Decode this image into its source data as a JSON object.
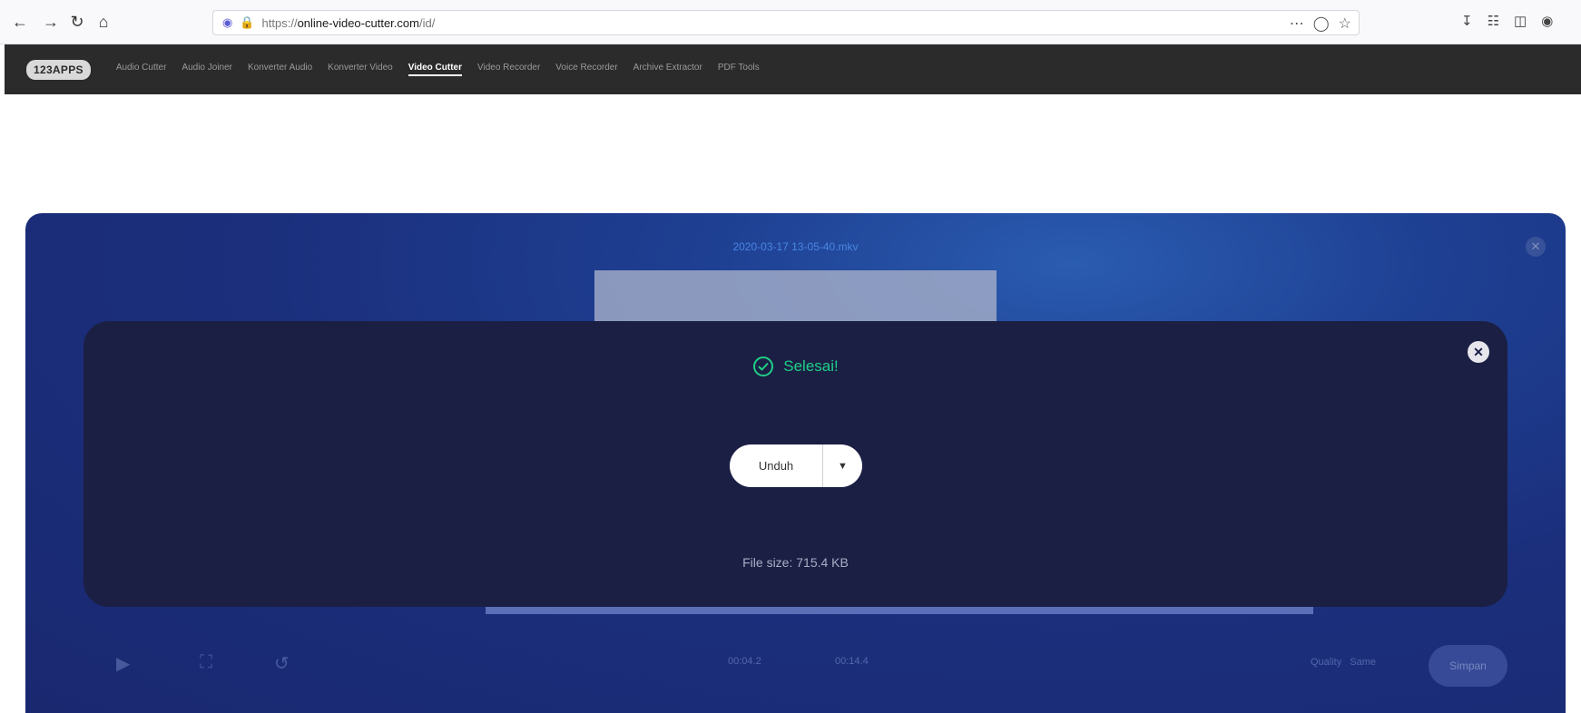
{
  "browser": {
    "url_prefix": "https://",
    "url_domain": "online-video-cutter.com",
    "url_path": "/id/"
  },
  "site_nav": {
    "logo": "123APPS",
    "items": [
      {
        "label": "Audio Cutter"
      },
      {
        "label": "Audio Joiner"
      },
      {
        "label": "Konverter Audio"
      },
      {
        "label": "Konverter Video"
      },
      {
        "label": "Video Cutter",
        "active": true
      },
      {
        "label": "Video Recorder"
      },
      {
        "label": "Voice Recorder"
      },
      {
        "label": "Archive Extractor"
      },
      {
        "label": "PDF Tools"
      }
    ]
  },
  "editor": {
    "filename": "2020-03-17 13-05-40.mkv",
    "start_time": "00:04.2",
    "end_time": "00:14.4",
    "quality_label": "Quality",
    "quality_value": "Same",
    "save_label": "Simpan"
  },
  "modal": {
    "status": "Selesai!",
    "download_label": "Unduh",
    "file_size": "File size: 715.4 KB"
  },
  "colors": {
    "success": "#1fcf86",
    "modal_bg": "#1b1f44",
    "nav_bg": "#2b2b2b"
  }
}
